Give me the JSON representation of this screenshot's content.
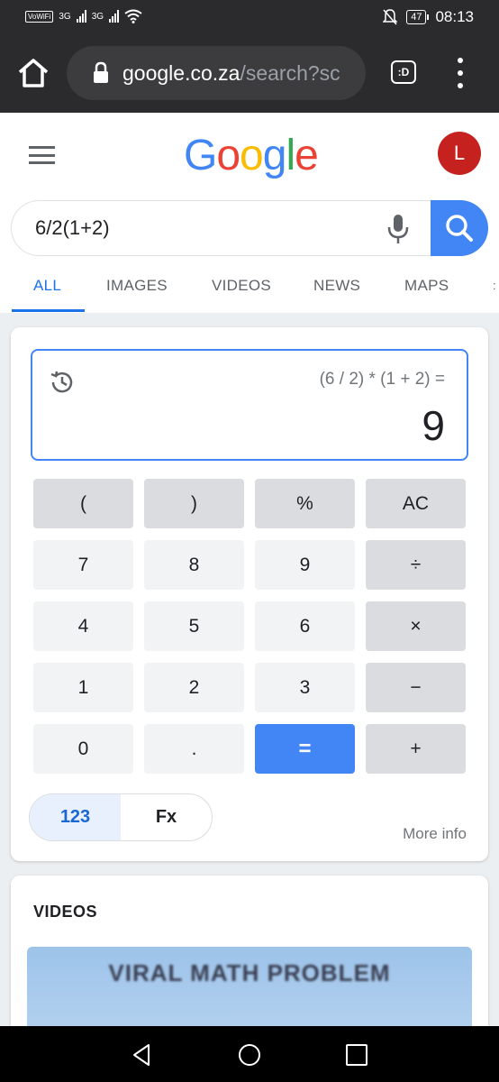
{
  "status_bar": {
    "wifi_chip": "VoWiFi",
    "net1": "3G",
    "net2": "3G",
    "battery": "47",
    "time": "08:13"
  },
  "browser": {
    "url_main": "google.co.za",
    "url_rest": "/search?sc",
    "tabs_label": ":D"
  },
  "google": {
    "logo": [
      {
        "ch": "G",
        "color": "#4285f4"
      },
      {
        "ch": "o",
        "color": "#ea4335"
      },
      {
        "ch": "o",
        "color": "#fbbc05"
      },
      {
        "ch": "g",
        "color": "#4285f4"
      },
      {
        "ch": "l",
        "color": "#34a853"
      },
      {
        "ch": "e",
        "color": "#ea4335"
      }
    ],
    "avatar_letter": "L",
    "query": "6/2(1+2)",
    "tabs": [
      "ALL",
      "IMAGES",
      "VIDEOS",
      "NEWS",
      "MAPS"
    ],
    "active_tab": "ALL"
  },
  "calculator": {
    "expression": "(6 / 2) * (1 + 2) =",
    "result": "9",
    "keys": [
      [
        "(",
        ")",
        "%",
        "AC"
      ],
      [
        "7",
        "8",
        "9",
        "÷"
      ],
      [
        "4",
        "5",
        "6",
        "×"
      ],
      [
        "1",
        "2",
        "3",
        "−"
      ],
      [
        "0",
        ".",
        "=",
        "+"
      ]
    ],
    "modes": [
      "123",
      "Fx"
    ],
    "active_mode": "123",
    "more_info": "More info"
  },
  "videos": {
    "heading": "VIDEOS",
    "thumbnail_title": "VIRAL MATH PROBLEM"
  },
  "colors": {
    "accent": "#4285f4",
    "tab_active": "#1a73e8",
    "avatar": "#c5221f",
    "chrome_bar": "#2b2b2d"
  }
}
